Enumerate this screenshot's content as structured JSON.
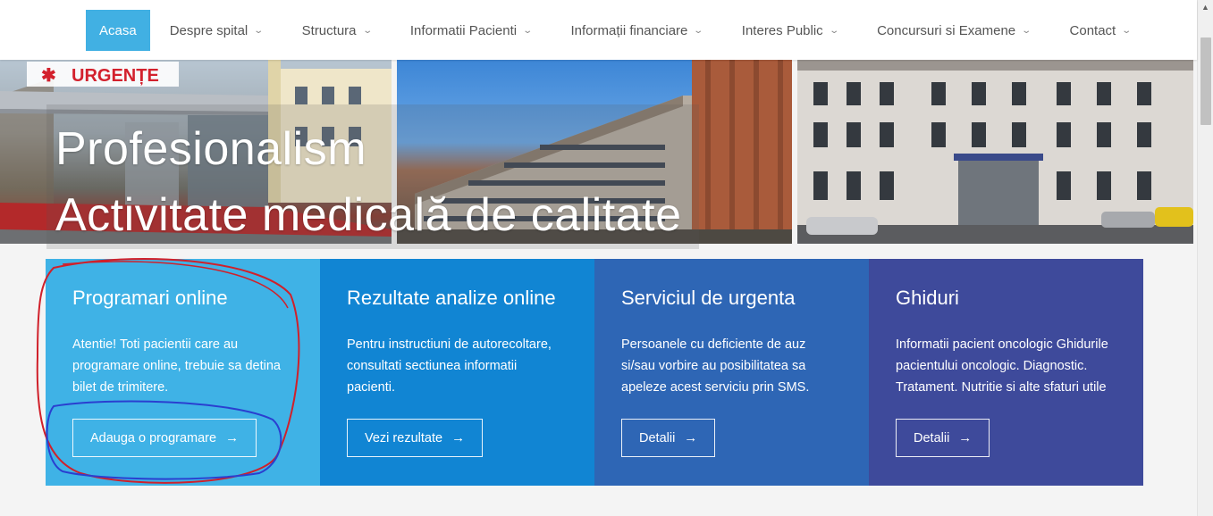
{
  "nav": {
    "items": [
      {
        "label": "Acasa",
        "active": true,
        "dropdown": false
      },
      {
        "label": "Despre spital",
        "dropdown": true
      },
      {
        "label": "Structura",
        "dropdown": true
      },
      {
        "label": "Informatii Pacienti",
        "dropdown": true
      },
      {
        "label": "Informații financiare",
        "dropdown": true
      },
      {
        "label": "Interes Public",
        "dropdown": true
      },
      {
        "label": "Concursuri si Examene",
        "dropdown": true
      },
      {
        "label": "Contact",
        "dropdown": true
      }
    ],
    "chevron_icon": "chevron-down-icon",
    "active_color": "#41b0e3"
  },
  "hero": {
    "line1": "Profesionalism",
    "line2": "Activitate medicală de calitate",
    "sign_text": "URGENȚE"
  },
  "cards": [
    {
      "title": "Programari online",
      "text": "Atentie! Toti pacientii care au programare online, trebuie sa detina bilet de trimitere.",
      "button": "Adauga o programare",
      "color": "#3fb2e6"
    },
    {
      "title": "Rezultate analize online",
      "text": "Pentru instructiuni de autorecoltare, consultati sectiunea informatii pacienti.",
      "button": "Vezi rezultate",
      "color": "#1185d3"
    },
    {
      "title": "Serviciul de urgenta",
      "text": "Persoanele cu deficiente de auz si/sau vorbire au posibilitatea sa apeleze acest serviciu prin SMS.",
      "button": "Detalii",
      "color": "#2e66b5"
    },
    {
      "title": "Ghiduri",
      "text": "Informatii pacient oncologic Ghidurile pacientului oncologic. Diagnostic. Tratament. Nutritie si alte sfaturi utile",
      "button": "Detalii",
      "color": "#3e4a9b"
    }
  ],
  "button_arrow": "→",
  "annotation_colors": {
    "red": "#d0202a",
    "blue": "#2a3fd0"
  }
}
